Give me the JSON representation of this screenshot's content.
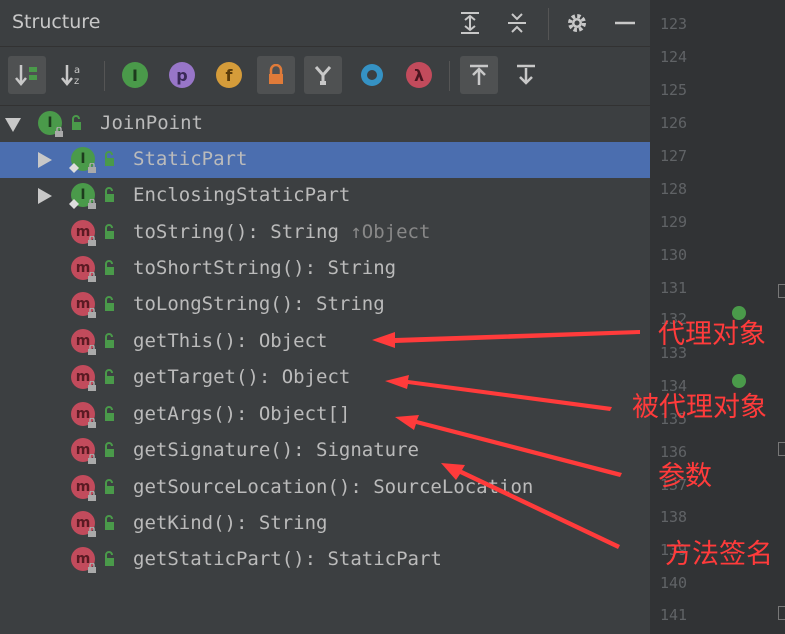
{
  "panel": {
    "title": "Structure"
  },
  "colors": {
    "panel_bg": "#3c3f41",
    "selection": "#4b6eaf",
    "interface_badge": "#4a9a4a",
    "method_badge": "#c24b5c",
    "annotation": "#ff3b3b"
  },
  "toolbar": {
    "tools": [
      {
        "icon": "sort-by-visibility-icon",
        "glyph": "↓"
      },
      {
        "icon": "sort-alphabetically-icon",
        "glyph": "↓a"
      },
      {
        "icon": "show-inherited-icon",
        "glyph": "I"
      },
      {
        "icon": "show-properties-icon",
        "glyph": "p"
      },
      {
        "icon": "show-fields-icon",
        "glyph": "f"
      },
      {
        "icon": "show-non-public-icon",
        "glyph": ""
      },
      {
        "icon": "show-anonymous-classes-icon",
        "glyph": ""
      },
      {
        "icon": "show-lambdas-circle-icon",
        "glyph": ""
      },
      {
        "icon": "show-lambdas-icon",
        "glyph": "λ"
      },
      {
        "icon": "autoscroll-to-source-icon",
        "glyph": ""
      },
      {
        "icon": "autoscroll-from-source-icon",
        "glyph": ""
      }
    ]
  },
  "tree": [
    {
      "label": "JoinPoint",
      "suffix": "",
      "kind": "interface",
      "expanded": true
    },
    {
      "label": "StaticPart",
      "suffix": "",
      "kind": "interface",
      "collapsed": true,
      "selected": true
    },
    {
      "label": "EnclosingStaticPart",
      "suffix": "",
      "kind": "interface",
      "collapsed": true
    },
    {
      "label": "toString(): String ",
      "suffix": "↑Object",
      "kind": "method"
    },
    {
      "label": "toShortString(): String",
      "suffix": "",
      "kind": "method"
    },
    {
      "label": "toLongString(): String",
      "suffix": "",
      "kind": "method"
    },
    {
      "label": "getThis(): Object",
      "suffix": "",
      "kind": "method"
    },
    {
      "label": "getTarget(): Object",
      "suffix": "",
      "kind": "method"
    },
    {
      "label": "getArgs(): Object[]",
      "suffix": "",
      "kind": "method"
    },
    {
      "label": "getSignature(): Signature",
      "suffix": "",
      "kind": "method"
    },
    {
      "label": "getSourceLocation(): SourceLocation",
      "suffix": "",
      "kind": "method"
    },
    {
      "label": "getKind(): String",
      "suffix": "",
      "kind": "method"
    },
    {
      "label": "getStaticPart(): StaticPart",
      "suffix": "",
      "kind": "method"
    }
  ],
  "gutter": {
    "lines": [
      "123",
      "124",
      "125",
      "126",
      "127",
      "128",
      "129",
      "130",
      "131",
      "132",
      "133",
      "134",
      "135",
      "136",
      "137",
      "138",
      "139",
      "140",
      "141"
    ]
  },
  "annotations": [
    {
      "text": "代理对象"
    },
    {
      "text": "被代理对象"
    },
    {
      "text": "参数"
    },
    {
      "text": "方法签名"
    }
  ]
}
